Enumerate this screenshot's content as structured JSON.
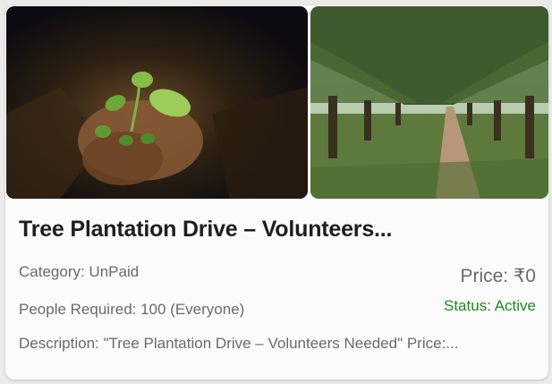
{
  "card": {
    "title": "Tree Plantation Drive – Volunteers...",
    "category": "Category: UnPaid",
    "price": "Price: ₹0",
    "people_required": "People Required: 100 (Everyone)",
    "status": "Status: Active",
    "description": "Description: \"Tree Plantation Drive – Volunteers Needed\" Price:...",
    "status_color": "#1f8a1f"
  },
  "images": [
    {
      "subject": "hands holding seedling"
    },
    {
      "subject": "tree-lined path"
    }
  ]
}
